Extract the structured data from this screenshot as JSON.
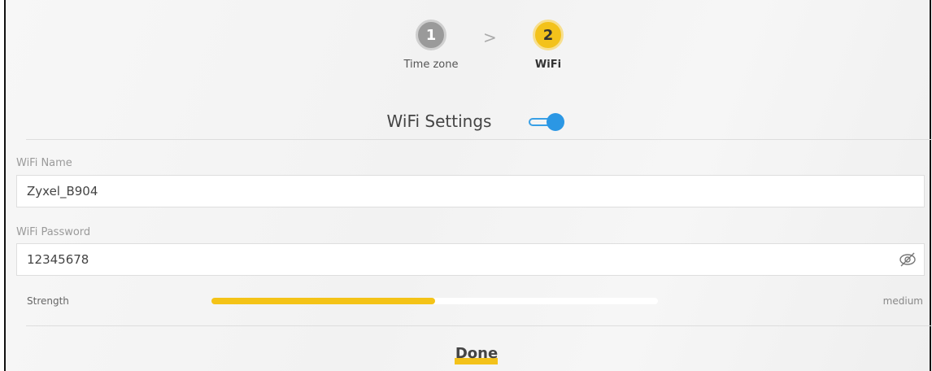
{
  "wizard": {
    "steps": [
      {
        "number": "1",
        "label": "Time zone",
        "state": "done"
      },
      {
        "number": "2",
        "label": "WiFi",
        "state": "active"
      }
    ],
    "separator": ">"
  },
  "wifi_settings": {
    "title": "WiFi Settings",
    "toggle_on": true,
    "accent_color": "#2b97e4"
  },
  "name_field": {
    "label": "WiFi Name",
    "value": "Zyxel_B904"
  },
  "password_field": {
    "label": "WiFi Password",
    "value": "12345678",
    "reveal_icon": "eye-slash-icon"
  },
  "strength": {
    "label": "Strength",
    "value": "medium",
    "level_fraction": 0.5,
    "fill_color": "#f4c317"
  },
  "done_button": {
    "label": "Done"
  }
}
